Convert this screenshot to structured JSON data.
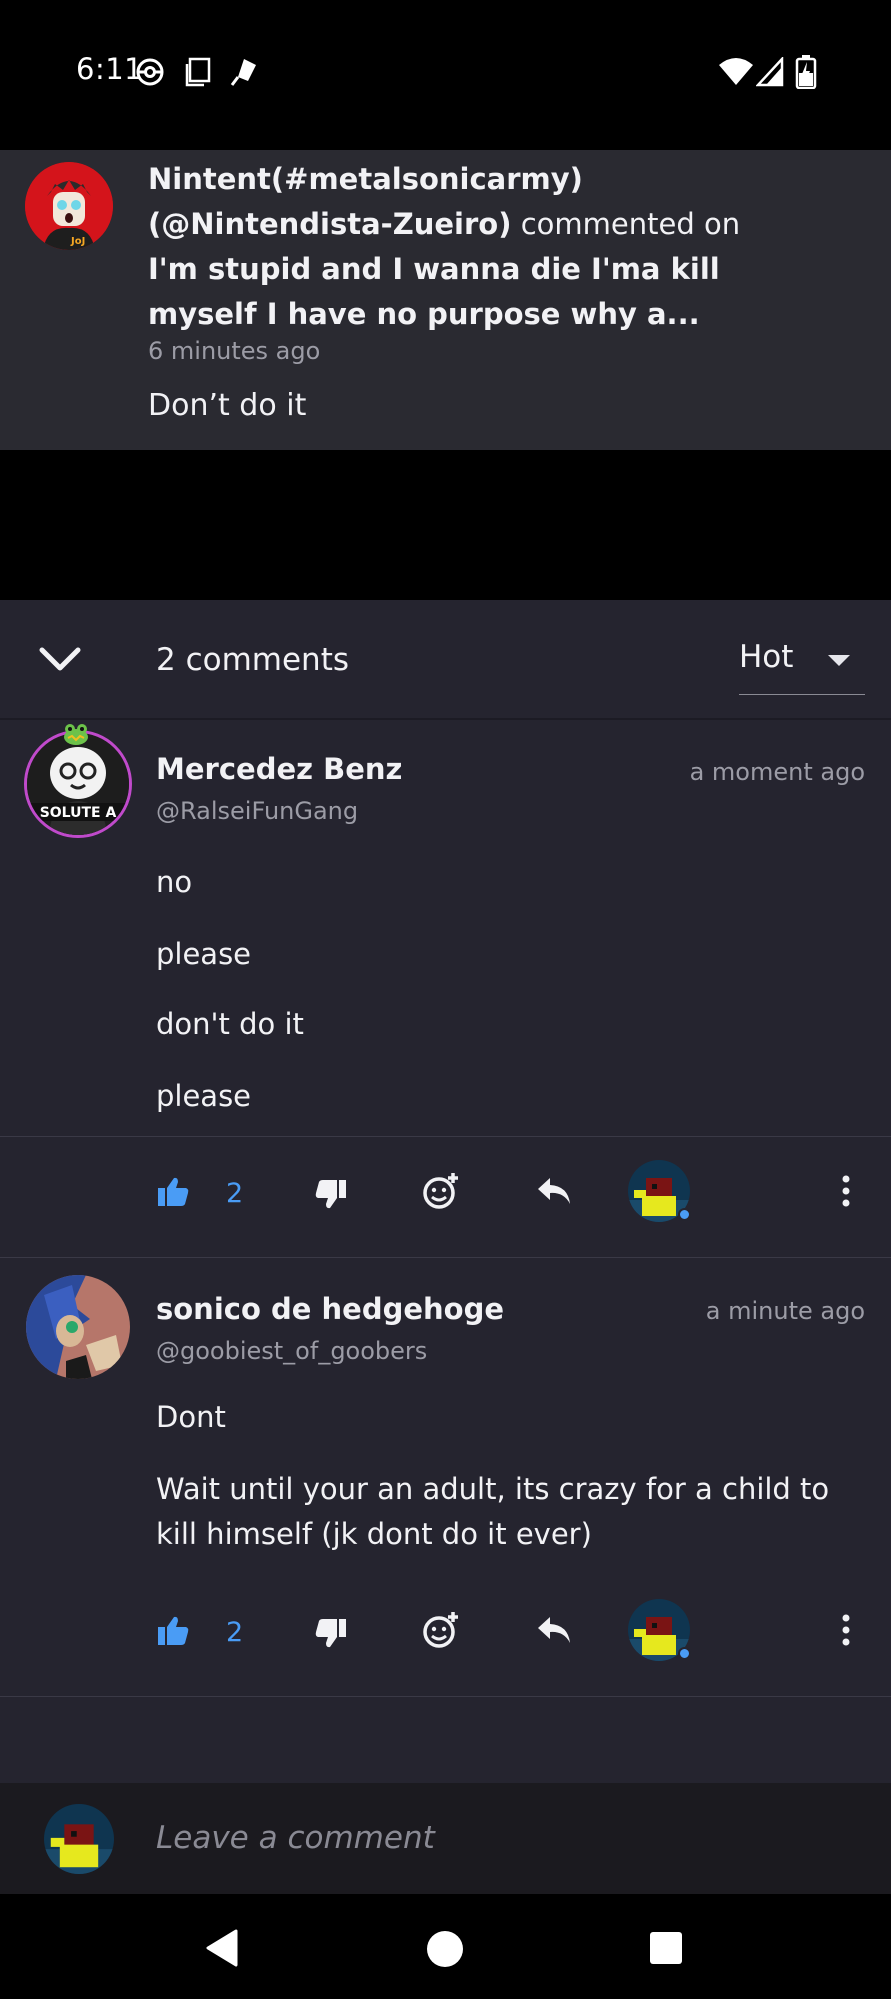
{
  "status_bar": {
    "time": "6:11",
    "icons": [
      "pokeball-icon",
      "screenshot-icon",
      "tag-icon",
      "wifi-icon",
      "signal-icon",
      "battery-charging-icon"
    ]
  },
  "notification": {
    "user_name": "Nintent(#metalsonicarmy)",
    "user_handle": "(@Nintendista-Zueiro)",
    "action_text": "commented on",
    "post_title": "I'm stupid and I wanna die I'ma kill myself I have no purpose why a...",
    "time": "6 minutes ago",
    "body": "Don’t do it"
  },
  "comments_header": {
    "count_label": "2 comments",
    "sort_value": "Hot"
  },
  "comments": [
    {
      "name": "Mercedez Benz",
      "handle": "@RalseiFunGang",
      "time": "a moment ago",
      "avatar_text": "SOLUTE A",
      "lines": [
        "no",
        "please",
        "don't do it",
        "please"
      ],
      "likes": "2"
    },
    {
      "name": "sonico de hedgehoge",
      "handle": "@goobiest_of_goobers",
      "time": "a minute ago",
      "lines": [
        "Dont",
        "Wait until your an adult, its crazy for a child to kill himself (jk dont do it ever)"
      ],
      "likes": "2"
    }
  ],
  "composer": {
    "placeholder": "Leave a comment"
  },
  "colors": {
    "panel_bg": "#25242f",
    "notification_bg": "#2a2a31",
    "accent_blue": "#4a9cf5",
    "muted_text": "#9c9ca6"
  }
}
